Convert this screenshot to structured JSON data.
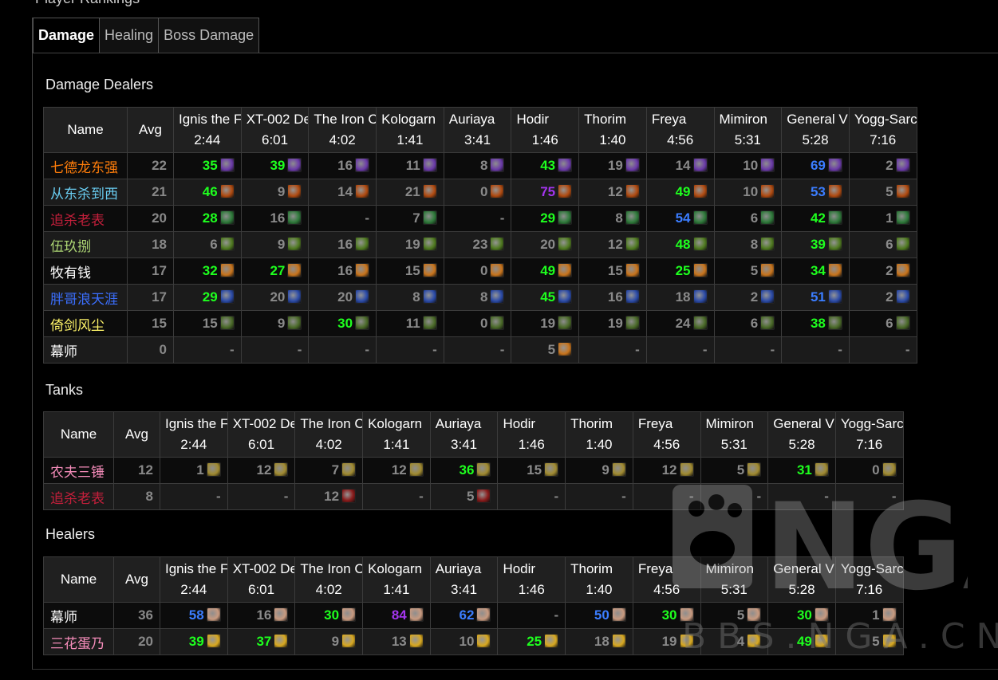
{
  "page": {
    "heading_fragment": "Player Rankings"
  },
  "tabs": [
    {
      "label": "Damage",
      "active": true
    },
    {
      "label": "Healing",
      "active": false
    },
    {
      "label": "Boss Damage",
      "active": false
    }
  ],
  "headers": {
    "name": "Name",
    "avg": "Avg"
  },
  "bosses": [
    {
      "name": "Ignis the F",
      "time": "2:44"
    },
    {
      "name": "XT-002 De",
      "time": "6:01"
    },
    {
      "name": "The Iron C",
      "time": "4:02"
    },
    {
      "name": "Kologarn",
      "time": "1:41"
    },
    {
      "name": "Auriaya",
      "time": "3:41"
    },
    {
      "name": "Hodir",
      "time": "1:46"
    },
    {
      "name": "Thorim",
      "time": "1:40"
    },
    {
      "name": "Freya",
      "time": "4:56"
    },
    {
      "name": "Mimiron",
      "time": "5:31"
    },
    {
      "name": "General V",
      "time": "5:28"
    },
    {
      "name": "Yogg-Sarc",
      "time": "7:16"
    }
  ],
  "sections": [
    {
      "title": "Damage Dealers",
      "rows": [
        {
          "name": "七德龙东强",
          "color": "#ff7d0a",
          "avg": "22",
          "avg_color": "",
          "icon": "arcane-spell-icon",
          "icon_color": "#6a3aa8",
          "cells": [
            [
              "35",
              "green"
            ],
            [
              "39",
              "green"
            ],
            [
              "16",
              ""
            ],
            [
              "11",
              ""
            ],
            [
              "8",
              ""
            ],
            [
              "43",
              "green"
            ],
            [
              "19",
              ""
            ],
            [
              "14",
              ""
            ],
            [
              "10",
              ""
            ],
            [
              "69",
              "blue"
            ],
            [
              "2",
              ""
            ]
          ]
        },
        {
          "name": "从东杀到西",
          "color": "#69ccf0",
          "avg": "21",
          "avg_color": "",
          "icon": "fireball-icon",
          "icon_color": "#b04a10",
          "cells": [
            [
              "46",
              "green"
            ],
            [
              "9",
              ""
            ],
            [
              "14",
              ""
            ],
            [
              "21",
              ""
            ],
            [
              "0",
              ""
            ],
            [
              "75",
              "purple"
            ],
            [
              "12",
              ""
            ],
            [
              "49",
              "green"
            ],
            [
              "10",
              ""
            ],
            [
              "53",
              "blue"
            ],
            [
              "5",
              ""
            ]
          ]
        },
        {
          "name": "追杀老表",
          "color": "#c41f3b",
          "avg": "20",
          "avg_color": "",
          "icon": "skull-green-icon",
          "icon_color": "#2e7a3a",
          "cells": [
            [
              "28",
              "green"
            ],
            [
              "16",
              ""
            ],
            [
              "-",
              "dash"
            ],
            [
              "7",
              ""
            ],
            [
              "-",
              "dash"
            ],
            [
              "29",
              "green"
            ],
            [
              "8",
              ""
            ],
            [
              "54",
              "blue"
            ],
            [
              "6",
              ""
            ],
            [
              "42",
              "green"
            ],
            [
              "1",
              ""
            ]
          ]
        },
        {
          "name": "伍玖捌",
          "color": "#abd473",
          "avg": "18",
          "avg_color": "",
          "icon": "beast-claw-icon",
          "icon_color": "#4f7a20",
          "cells": [
            [
              "6",
              ""
            ],
            [
              "9",
              ""
            ],
            [
              "16",
              ""
            ],
            [
              "19",
              ""
            ],
            [
              "23",
              ""
            ],
            [
              "20",
              ""
            ],
            [
              "12",
              ""
            ],
            [
              "48",
              "green"
            ],
            [
              "8",
              ""
            ],
            [
              "39",
              "green"
            ],
            [
              "6",
              ""
            ]
          ]
        },
        {
          "name": "牧有钱",
          "color": "#ffffff",
          "avg": "17",
          "avg_color": "",
          "icon": "shadow-skull-icon",
          "icon_color": "#c8741c",
          "cells": [
            [
              "32",
              "green"
            ],
            [
              "27",
              "green"
            ],
            [
              "16",
              ""
            ],
            [
              "15",
              ""
            ],
            [
              "0",
              ""
            ],
            [
              "49",
              "green"
            ],
            [
              "15",
              ""
            ],
            [
              "25",
              "green"
            ],
            [
              "5",
              ""
            ],
            [
              "34",
              "green"
            ],
            [
              "2",
              ""
            ]
          ]
        },
        {
          "name": "胖哥浪天涯",
          "color": "#3b6fff",
          "avg": "17",
          "avg_color": "",
          "icon": "lightning-icon",
          "icon_color": "#2a4aa8",
          "cells": [
            [
              "29",
              "green"
            ],
            [
              "20",
              ""
            ],
            [
              "20",
              ""
            ],
            [
              "8",
              ""
            ],
            [
              "8",
              ""
            ],
            [
              "45",
              "green"
            ],
            [
              "16",
              ""
            ],
            [
              "18",
              ""
            ],
            [
              "2",
              ""
            ],
            [
              "51",
              "blue"
            ],
            [
              "2",
              ""
            ]
          ]
        },
        {
          "name": "倚剑风尘",
          "color": "#fff569",
          "avg": "15",
          "avg_color": "",
          "icon": "crossed-swords-icon",
          "icon_color": "#4a6a28",
          "cells": [
            [
              "15",
              ""
            ],
            [
              "9",
              ""
            ],
            [
              "30",
              "green"
            ],
            [
              "11",
              ""
            ],
            [
              "0",
              ""
            ],
            [
              "19",
              ""
            ],
            [
              "19",
              ""
            ],
            [
              "24",
              ""
            ],
            [
              "6",
              ""
            ],
            [
              "38",
              "green"
            ],
            [
              "6",
              ""
            ]
          ]
        },
        {
          "name": "幕师",
          "color": "#ffffff",
          "avg": "0",
          "avg_color": "",
          "icon": "shadow-skull-icon",
          "icon_color": "#c8741c",
          "cells": [
            [
              "-",
              "dash"
            ],
            [
              "-",
              "dash"
            ],
            [
              "-",
              "dash"
            ],
            [
              "-",
              "dash"
            ],
            [
              "-",
              "dash"
            ],
            [
              "5",
              "icon"
            ],
            [
              "-",
              "dash"
            ],
            [
              "-",
              "dash"
            ],
            [
              "-",
              "dash"
            ],
            [
              "-",
              "dash"
            ],
            [
              "-",
              "dash"
            ]
          ]
        }
      ]
    },
    {
      "title": "Tanks",
      "rows": [
        {
          "name": "农夫三锤",
          "color": "#f58cba",
          "avg": "12",
          "avg_color": "",
          "icon": "holy-shield-icon",
          "icon_color": "#a08a30",
          "cells": [
            [
              "1",
              ""
            ],
            [
              "12",
              ""
            ],
            [
              "7",
              ""
            ],
            [
              "12",
              ""
            ],
            [
              "36",
              "green"
            ],
            [
              "15",
              ""
            ],
            [
              "9",
              ""
            ],
            [
              "12",
              ""
            ],
            [
              "5",
              ""
            ],
            [
              "31",
              "green"
            ],
            [
              "0",
              ""
            ]
          ]
        },
        {
          "name": "追杀老表",
          "color": "#c41f3b",
          "avg": "8",
          "avg_color": "",
          "icon": "blood-mouth-icon",
          "icon_color": "#8a1a1a",
          "cells": [
            [
              "-",
              "dash"
            ],
            [
              "-",
              "dash"
            ],
            [
              "12",
              ""
            ],
            [
              "-",
              "dash"
            ],
            [
              "5",
              ""
            ],
            [
              "-",
              "dash"
            ],
            [
              "-",
              "dash"
            ],
            [
              "-",
              "dash"
            ],
            [
              "-",
              "dash"
            ],
            [
              "-",
              "dash"
            ],
            [
              "-",
              "dash"
            ]
          ]
        }
      ]
    },
    {
      "title": "Healers",
      "rows": [
        {
          "name": "幕师",
          "color": "#ffffff",
          "avg": "36",
          "avg_color": "green",
          "icon": "holy-nova-icon",
          "icon_color": "#c89a80",
          "cells": [
            [
              "58",
              "blue"
            ],
            [
              "16",
              ""
            ],
            [
              "30",
              "green"
            ],
            [
              "84",
              "purple"
            ],
            [
              "62",
              "blue"
            ],
            [
              "-",
              "dash"
            ],
            [
              "50",
              "blue"
            ],
            [
              "30",
              "green"
            ],
            [
              "5",
              ""
            ],
            [
              "30",
              "green"
            ],
            [
              "1",
              ""
            ]
          ]
        },
        {
          "name": "三花蛋乃",
          "color": "#f58cba",
          "avg": "20",
          "avg_color": "",
          "icon": "holy-light-icon",
          "icon_color": "#d8a820",
          "cells": [
            [
              "39",
              "green"
            ],
            [
              "37",
              "green"
            ],
            [
              "9",
              ""
            ],
            [
              "13",
              ""
            ],
            [
              "10",
              ""
            ],
            [
              "25",
              "green"
            ],
            [
              "18",
              ""
            ],
            [
              "19",
              ""
            ],
            [
              "4",
              ""
            ],
            [
              "49",
              "green"
            ],
            [
              "5",
              ""
            ]
          ]
        }
      ]
    }
  ],
  "watermark": {
    "logo": "NGA",
    "url": "BBS.NGA.CN",
    "logo_icon": "paw-logo-icon"
  }
}
